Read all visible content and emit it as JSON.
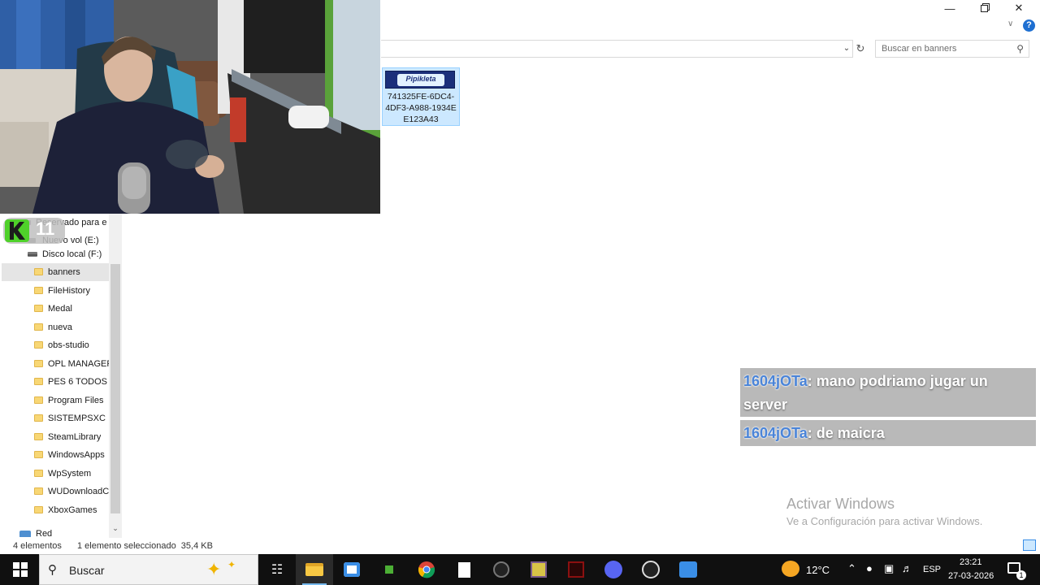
{
  "window": {
    "minimize_icon": "minimize-icon",
    "maximize_icon": "restore-icon",
    "close_icon": "close-icon",
    "help_label": "?"
  },
  "address_bar": {
    "search_placeholder": "Buscar en banners"
  },
  "file": {
    "thumbnail_text": "Pipikleta",
    "name": "741325FE-6DC4-4DF3-A988-1934EE123A43"
  },
  "overlay": {
    "logo_text": "11"
  },
  "nav_pane": {
    "items": [
      {
        "label": "Reservado para e",
        "icon": "drive-icon"
      },
      {
        "label": "Nuevo vol (E:)",
        "icon": "drive-icon"
      },
      {
        "label": "Disco local (F:)",
        "icon": "drive-icon"
      },
      {
        "label": "banners",
        "icon": "folder-icon",
        "selected": true
      },
      {
        "label": "FileHistory",
        "icon": "folder-icon"
      },
      {
        "label": "Medal",
        "icon": "folder-icon"
      },
      {
        "label": "nueva",
        "icon": "folder-icon"
      },
      {
        "label": "obs-studio",
        "icon": "folder-icon"
      },
      {
        "label": "OPL MANAGER",
        "icon": "folder-icon"
      },
      {
        "label": "PES 6 TODOS",
        "icon": "folder-icon"
      },
      {
        "label": "Program Files",
        "icon": "folder-icon"
      },
      {
        "label": "SISTEMPSXC",
        "icon": "folder-icon"
      },
      {
        "label": "SteamLibrary",
        "icon": "folder-icon"
      },
      {
        "label": "WindowsApps",
        "icon": "folder-icon"
      },
      {
        "label": "WpSystem",
        "icon": "folder-icon"
      },
      {
        "label": "WUDownloadC",
        "icon": "folder-icon"
      },
      {
        "label": "XboxGames",
        "icon": "folder-icon"
      },
      {
        "label": "Red",
        "icon": "network-icon"
      }
    ]
  },
  "status_bar": {
    "count": "4 elementos",
    "selection": "1 elemento seleccionado  35,4 KB"
  },
  "chat": {
    "messages": [
      {
        "user": "1604jOTa",
        "text": ": mano podriamo jugar un server"
      },
      {
        "user": "1604jOTa",
        "text": ": de maicra"
      }
    ]
  },
  "watermark": {
    "title": "Activar Windows",
    "subtitle": "Ve a Configuración para activar Windows."
  },
  "taskbar": {
    "search_label": "Buscar",
    "apps": [
      "task-view-icon",
      "file-explorer-icon",
      "store-icon",
      "minecraft-icon",
      "chrome-icon",
      "notepad-icon",
      "game-icon",
      "winrar-icon",
      "app-red-icon",
      "discord-icon",
      "obs-icon",
      "photos-icon"
    ],
    "weather": "12°C",
    "language": "ESP",
    "time": "23:21",
    "date": "27-03-2026",
    "notifications": "1"
  }
}
